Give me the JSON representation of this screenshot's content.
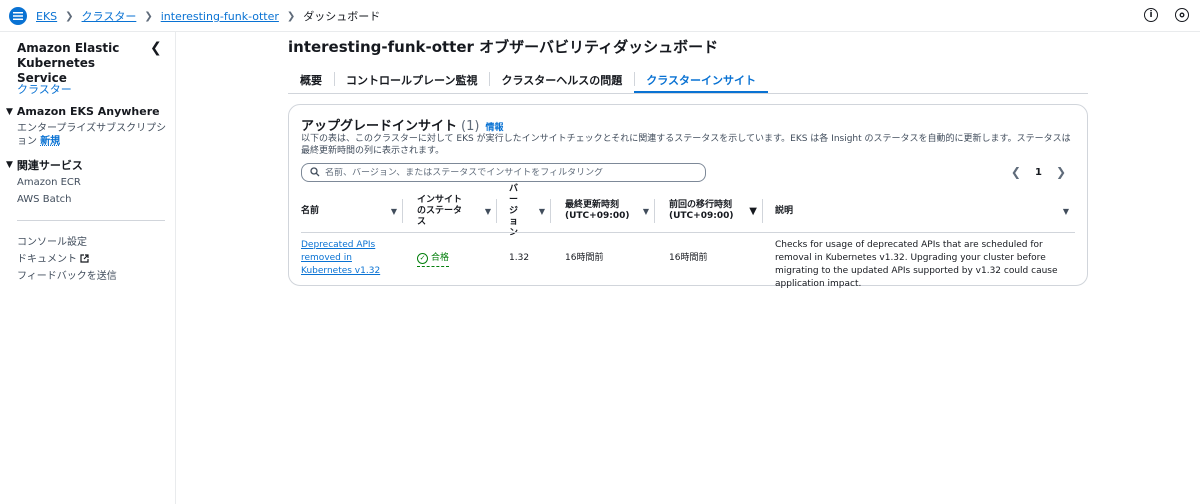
{
  "topbar": {
    "breadcrumbs": [
      "EKS",
      "クラスター",
      "interesting-funk-otter",
      "ダッシュボード"
    ]
  },
  "sidebar": {
    "title": "Amazon Elastic Kubernetes Service",
    "cluster_link": "クラスター",
    "eks_anywhere": "Amazon EKS Anywhere",
    "enterprise": "エンタープライズサブスクリプション",
    "new_badge": "新規",
    "related": "関連サービス",
    "ecr": "Amazon ECR",
    "batch": "AWS Batch",
    "console_settings": "コンソール設定",
    "docs": "ドキュメント",
    "feedback": "フィードバックを送信"
  },
  "main": {
    "title": "interesting-funk-otter オブザーバビリティダッシュボード",
    "tabs": [
      {
        "label": "概要"
      },
      {
        "label": "コントロールプレーン監視"
      },
      {
        "label": "クラスターヘルスの問題"
      },
      {
        "label": "クラスターインサイト"
      }
    ]
  },
  "panel": {
    "title": "アップグレードインサイト",
    "count": "(1)",
    "info": "情報",
    "description": "以下の表は、このクラスターに対して EKS が実行したインサイトチェックとそれに関連するステータスを示しています。EKS は各 Insight のステータスを自動的に更新します。ステータスは最終更新時間の列に表示されます。",
    "search_placeholder": "名前、バージョン、またはステータスでインサイトをフィルタリング",
    "page": "1"
  },
  "table": {
    "headers": {
      "name": "名前",
      "status": "インサイトのステータス",
      "version": "バージョン",
      "last_updated": "最終更新時刻 (UTC+09:00)",
      "last_transition": "前回の移行時刻 (UTC+09:00)",
      "description": "説明"
    },
    "rows": [
      {
        "name": "Deprecated APIs removed in Kubernetes v1.32",
        "status": "合格",
        "version": "1.32",
        "last_updated": "16時間前",
        "last_transition": "16時間前",
        "description": "Checks for usage of deprecated APIs that are scheduled for removal in Kubernetes v1.32. Upgrading your cluster before migrating to the updated APIs supported by v1.32 could cause application impact."
      }
    ]
  },
  "colors": {
    "accent": "#0972d3",
    "success": "#037f0c",
    "text": "#16191f"
  }
}
